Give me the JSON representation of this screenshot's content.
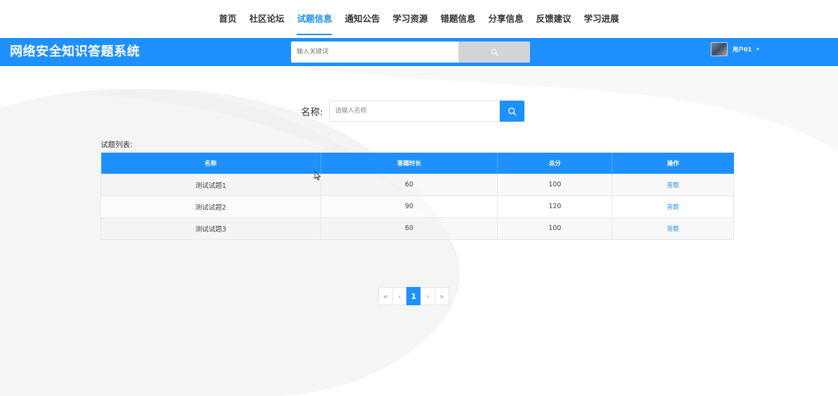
{
  "topnav": {
    "items": [
      {
        "label": "首页"
      },
      {
        "label": "社区论坛"
      },
      {
        "label": "试题信息",
        "active": true
      },
      {
        "label": "通知公告"
      },
      {
        "label": "学习资源"
      },
      {
        "label": "错题信息"
      },
      {
        "label": "分享信息"
      },
      {
        "label": "反馈建议"
      },
      {
        "label": "学习进展"
      }
    ]
  },
  "header": {
    "brand": "网络安全知识答题系统",
    "search_placeholder": "输入关键词",
    "search_icon": "search-icon",
    "username": "用户01",
    "caret": "▾",
    "accent_color": "#1e90ff"
  },
  "filter": {
    "label": "名称:",
    "placeholder": "请输入名称",
    "search_icon": "search-icon"
  },
  "list": {
    "title": "试题列表:",
    "columns": [
      "名称",
      "答题时长",
      "总分",
      "操作"
    ],
    "rows": [
      {
        "name": "测试试题1",
        "duration": "60",
        "score": "100",
        "action": "答题"
      },
      {
        "name": "测试试题2",
        "duration": "90",
        "score": "120",
        "action": "答题"
      },
      {
        "name": "测试试题3",
        "duration": "60",
        "score": "100",
        "action": "答题"
      }
    ]
  },
  "pager": {
    "first": "«",
    "prev": "‹",
    "current": "1",
    "next": "›",
    "last": "»"
  }
}
